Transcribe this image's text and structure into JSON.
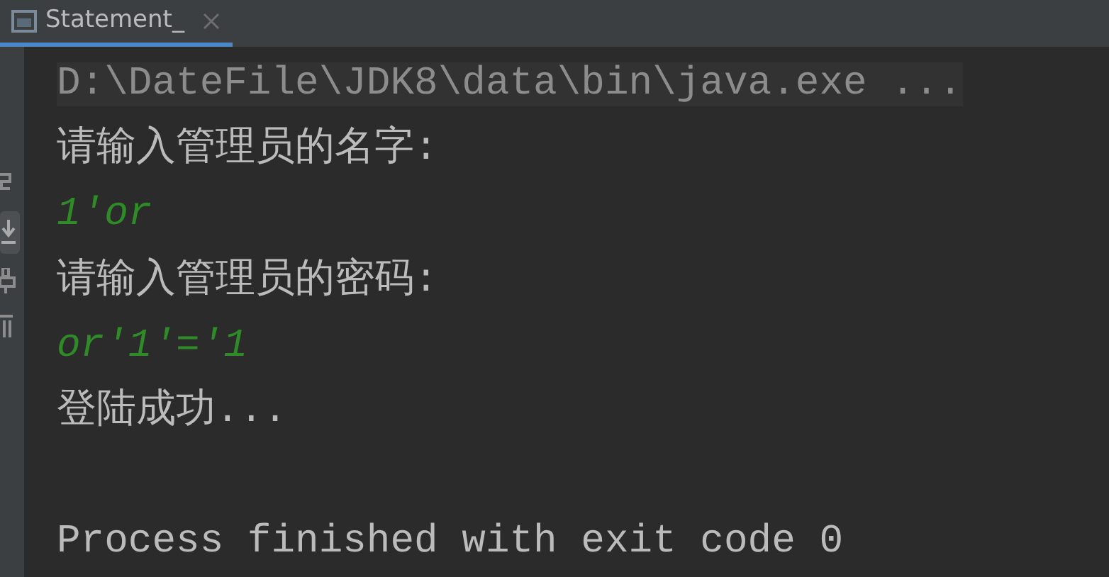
{
  "tabs": [
    {
      "label": "Statement_",
      "selected": true
    }
  ],
  "console": {
    "lines": [
      {
        "kind": "command",
        "text": "D:\\DateFile\\JDK8\\data\\bin\\java.exe ..."
      },
      {
        "kind": "output",
        "text": "请输入管理员的名字:"
      },
      {
        "kind": "input",
        "text": "1'or"
      },
      {
        "kind": "output",
        "text": "请输入管理员的密码:"
      },
      {
        "kind": "input",
        "text": "or'1'='1"
      },
      {
        "kind": "output",
        "text": "登陆成功..."
      },
      {
        "kind": "blank"
      },
      {
        "kind": "output",
        "text": "Process finished with exit code 0"
      }
    ]
  }
}
